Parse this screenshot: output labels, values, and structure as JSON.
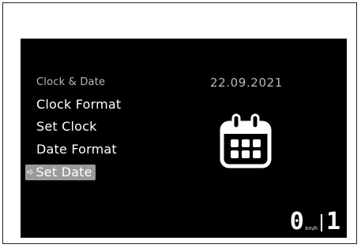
{
  "menu": {
    "title": "Clock & Date",
    "items": [
      {
        "label": "Clock Format"
      },
      {
        "label": "Set Clock"
      },
      {
        "label": "Date Format"
      },
      {
        "label": "Set Date",
        "selected": true
      }
    ],
    "selected_arrow": "➪"
  },
  "date_display": {
    "value": "22.09.2021"
  },
  "icons": {
    "main": "calendar-icon",
    "selection": "arrow-right-icon"
  },
  "status": {
    "speed": "0",
    "speed_unit": "km/h",
    "gear": "1"
  },
  "colors": {
    "screen_background": "#000000",
    "text_primary": "#ffffff",
    "text_secondary": "#b9b9b9",
    "selection_background": "#9a9a9a"
  }
}
